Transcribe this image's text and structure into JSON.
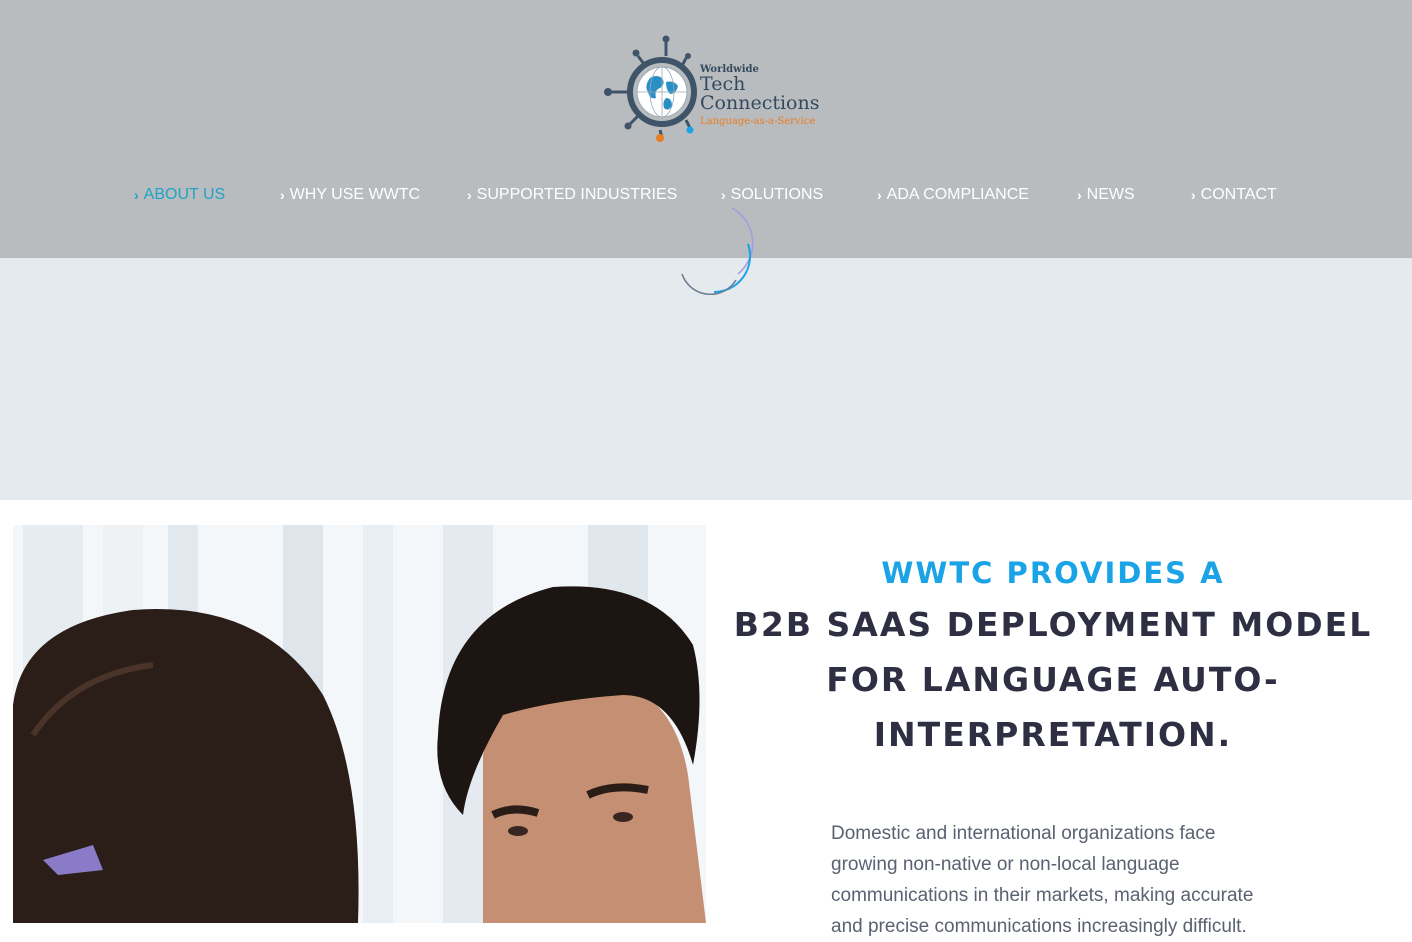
{
  "logo": {
    "small": "Worldwide",
    "line1": "Tech",
    "line2": "Connections",
    "tagline": "Language-as-a-Service"
  },
  "nav": {
    "items": [
      {
        "label": "ABOUT US",
        "active": true
      },
      {
        "label": "WHY USE WWTC"
      },
      {
        "label": "SUPPORTED INDUSTRIES"
      },
      {
        "label": "SOLUTIONS"
      },
      {
        "label": "ADA COMPLIANCE"
      },
      {
        "label": "NEWS"
      },
      {
        "label": "CONTACT"
      }
    ]
  },
  "hero": {
    "accent": "WWTC PROVIDES A",
    "line1": "B2B SAAS DEPLOYMENT MODEL",
    "line2": "FOR LANGUAGE AUTO-",
    "line3": "INTERPRETATION.",
    "body": "Domestic and international organizations face growing non-native or non-local language communications in their markets, making accurate and precise communications increasingly difficult."
  },
  "colors": {
    "header_bg": "#b9bcbf",
    "band_bg": "#e5eaee",
    "accent": "#1aa3e6",
    "nav_active": "#1fa3c7",
    "heading": "#2f2f43"
  },
  "icons": [
    "chevron-right-icon",
    "globe-logo-icon",
    "loading-spinner-icon"
  ]
}
